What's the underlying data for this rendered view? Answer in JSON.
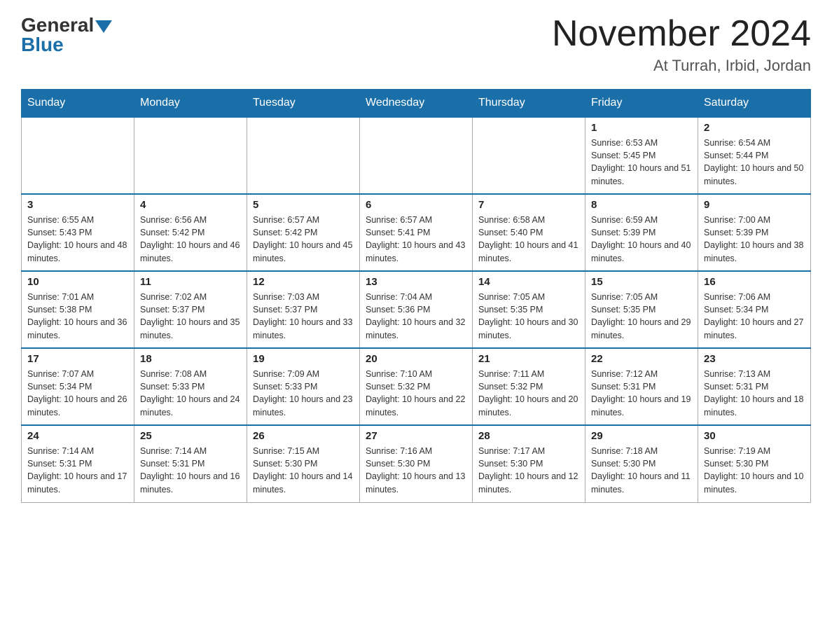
{
  "header": {
    "logo": {
      "general": "General",
      "blue": "Blue"
    },
    "month_title": "November 2024",
    "location": "At Turrah, Irbid, Jordan"
  },
  "days_of_week": [
    "Sunday",
    "Monday",
    "Tuesday",
    "Wednesday",
    "Thursday",
    "Friday",
    "Saturday"
  ],
  "weeks": [
    {
      "days": [
        {
          "num": "",
          "info": ""
        },
        {
          "num": "",
          "info": ""
        },
        {
          "num": "",
          "info": ""
        },
        {
          "num": "",
          "info": ""
        },
        {
          "num": "",
          "info": ""
        },
        {
          "num": "1",
          "info": "Sunrise: 6:53 AM\nSunset: 5:45 PM\nDaylight: 10 hours and 51 minutes."
        },
        {
          "num": "2",
          "info": "Sunrise: 6:54 AM\nSunset: 5:44 PM\nDaylight: 10 hours and 50 minutes."
        }
      ]
    },
    {
      "days": [
        {
          "num": "3",
          "info": "Sunrise: 6:55 AM\nSunset: 5:43 PM\nDaylight: 10 hours and 48 minutes."
        },
        {
          "num": "4",
          "info": "Sunrise: 6:56 AM\nSunset: 5:42 PM\nDaylight: 10 hours and 46 minutes."
        },
        {
          "num": "5",
          "info": "Sunrise: 6:57 AM\nSunset: 5:42 PM\nDaylight: 10 hours and 45 minutes."
        },
        {
          "num": "6",
          "info": "Sunrise: 6:57 AM\nSunset: 5:41 PM\nDaylight: 10 hours and 43 minutes."
        },
        {
          "num": "7",
          "info": "Sunrise: 6:58 AM\nSunset: 5:40 PM\nDaylight: 10 hours and 41 minutes."
        },
        {
          "num": "8",
          "info": "Sunrise: 6:59 AM\nSunset: 5:39 PM\nDaylight: 10 hours and 40 minutes."
        },
        {
          "num": "9",
          "info": "Sunrise: 7:00 AM\nSunset: 5:39 PM\nDaylight: 10 hours and 38 minutes."
        }
      ]
    },
    {
      "days": [
        {
          "num": "10",
          "info": "Sunrise: 7:01 AM\nSunset: 5:38 PM\nDaylight: 10 hours and 36 minutes."
        },
        {
          "num": "11",
          "info": "Sunrise: 7:02 AM\nSunset: 5:37 PM\nDaylight: 10 hours and 35 minutes."
        },
        {
          "num": "12",
          "info": "Sunrise: 7:03 AM\nSunset: 5:37 PM\nDaylight: 10 hours and 33 minutes."
        },
        {
          "num": "13",
          "info": "Sunrise: 7:04 AM\nSunset: 5:36 PM\nDaylight: 10 hours and 32 minutes."
        },
        {
          "num": "14",
          "info": "Sunrise: 7:05 AM\nSunset: 5:35 PM\nDaylight: 10 hours and 30 minutes."
        },
        {
          "num": "15",
          "info": "Sunrise: 7:05 AM\nSunset: 5:35 PM\nDaylight: 10 hours and 29 minutes."
        },
        {
          "num": "16",
          "info": "Sunrise: 7:06 AM\nSunset: 5:34 PM\nDaylight: 10 hours and 27 minutes."
        }
      ]
    },
    {
      "days": [
        {
          "num": "17",
          "info": "Sunrise: 7:07 AM\nSunset: 5:34 PM\nDaylight: 10 hours and 26 minutes."
        },
        {
          "num": "18",
          "info": "Sunrise: 7:08 AM\nSunset: 5:33 PM\nDaylight: 10 hours and 24 minutes."
        },
        {
          "num": "19",
          "info": "Sunrise: 7:09 AM\nSunset: 5:33 PM\nDaylight: 10 hours and 23 minutes."
        },
        {
          "num": "20",
          "info": "Sunrise: 7:10 AM\nSunset: 5:32 PM\nDaylight: 10 hours and 22 minutes."
        },
        {
          "num": "21",
          "info": "Sunrise: 7:11 AM\nSunset: 5:32 PM\nDaylight: 10 hours and 20 minutes."
        },
        {
          "num": "22",
          "info": "Sunrise: 7:12 AM\nSunset: 5:31 PM\nDaylight: 10 hours and 19 minutes."
        },
        {
          "num": "23",
          "info": "Sunrise: 7:13 AM\nSunset: 5:31 PM\nDaylight: 10 hours and 18 minutes."
        }
      ]
    },
    {
      "days": [
        {
          "num": "24",
          "info": "Sunrise: 7:14 AM\nSunset: 5:31 PM\nDaylight: 10 hours and 17 minutes."
        },
        {
          "num": "25",
          "info": "Sunrise: 7:14 AM\nSunset: 5:31 PM\nDaylight: 10 hours and 16 minutes."
        },
        {
          "num": "26",
          "info": "Sunrise: 7:15 AM\nSunset: 5:30 PM\nDaylight: 10 hours and 14 minutes."
        },
        {
          "num": "27",
          "info": "Sunrise: 7:16 AM\nSunset: 5:30 PM\nDaylight: 10 hours and 13 minutes."
        },
        {
          "num": "28",
          "info": "Sunrise: 7:17 AM\nSunset: 5:30 PM\nDaylight: 10 hours and 12 minutes."
        },
        {
          "num": "29",
          "info": "Sunrise: 7:18 AM\nSunset: 5:30 PM\nDaylight: 10 hours and 11 minutes."
        },
        {
          "num": "30",
          "info": "Sunrise: 7:19 AM\nSunset: 5:30 PM\nDaylight: 10 hours and 10 minutes."
        }
      ]
    }
  ]
}
